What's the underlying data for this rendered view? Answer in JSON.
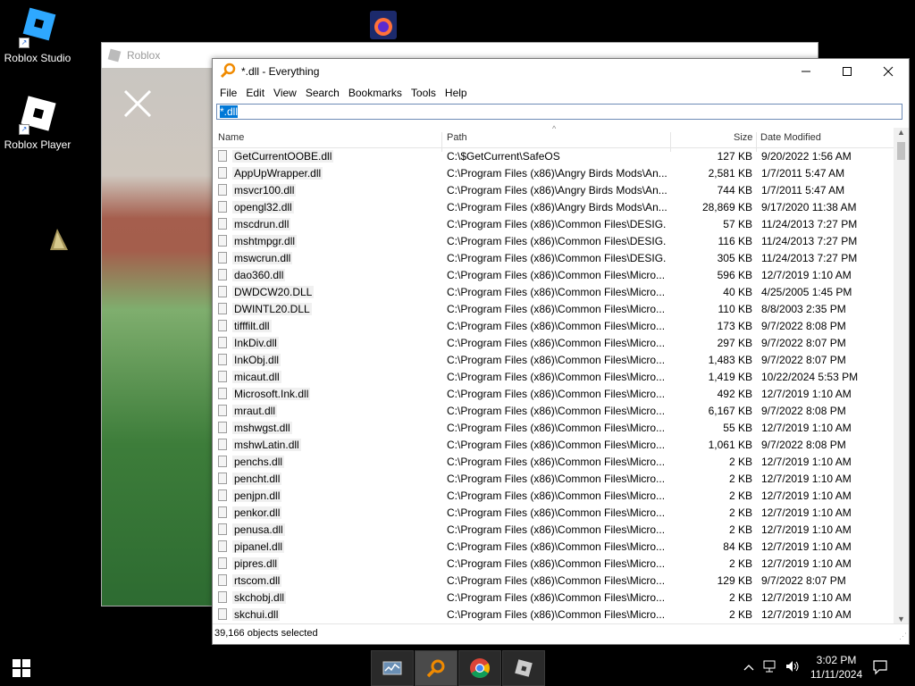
{
  "desktop": {
    "icons": [
      {
        "label": "Roblox Studio"
      },
      {
        "label": "Roblox Player"
      }
    ]
  },
  "roblox_window": {
    "title": "Roblox"
  },
  "everything": {
    "title": "*.dll - Everything",
    "menu": [
      "File",
      "Edit",
      "View",
      "Search",
      "Bookmarks",
      "Tools",
      "Help"
    ],
    "search_value": "*.dll",
    "columns": {
      "name": "Name",
      "path": "Path",
      "size": "Size",
      "date": "Date Modified"
    },
    "rows": [
      {
        "name": "GetCurrentOOBE.dll",
        "path": "C:\\$GetCurrent\\SafeOS",
        "size": "127 KB",
        "date": "9/20/2022 1:56 AM"
      },
      {
        "name": "AppUpWrapper.dll",
        "path": "C:\\Program Files (x86)\\Angry Birds Mods\\An...",
        "size": "2,581 KB",
        "date": "1/7/2011 5:47 AM"
      },
      {
        "name": "msvcr100.dll",
        "path": "C:\\Program Files (x86)\\Angry Birds Mods\\An...",
        "size": "744 KB",
        "date": "1/7/2011 5:47 AM"
      },
      {
        "name": "opengl32.dll",
        "path": "C:\\Program Files (x86)\\Angry Birds Mods\\An...",
        "size": "28,869 KB",
        "date": "9/17/2020 11:38 AM"
      },
      {
        "name": "mscdrun.dll",
        "path": "C:\\Program Files (x86)\\Common Files\\DESIG...",
        "size": "57 KB",
        "date": "11/24/2013 7:27 PM"
      },
      {
        "name": "mshtmpgr.dll",
        "path": "C:\\Program Files (x86)\\Common Files\\DESIG...",
        "size": "116 KB",
        "date": "11/24/2013 7:27 PM"
      },
      {
        "name": "mswcrun.dll",
        "path": "C:\\Program Files (x86)\\Common Files\\DESIG...",
        "size": "305 KB",
        "date": "11/24/2013 7:27 PM"
      },
      {
        "name": "dao360.dll",
        "path": "C:\\Program Files (x86)\\Common Files\\Micro...",
        "size": "596 KB",
        "date": "12/7/2019 1:10 AM"
      },
      {
        "name": "DWDCW20.DLL",
        "path": "C:\\Program Files (x86)\\Common Files\\Micro...",
        "size": "40 KB",
        "date": "4/25/2005 1:45 PM"
      },
      {
        "name": "DWINTL20.DLL",
        "path": "C:\\Program Files (x86)\\Common Files\\Micro...",
        "size": "110 KB",
        "date": "8/8/2003 2:35 PM"
      },
      {
        "name": "tifffilt.dll",
        "path": "C:\\Program Files (x86)\\Common Files\\Micro...",
        "size": "173 KB",
        "date": "9/7/2022 8:08 PM"
      },
      {
        "name": "InkDiv.dll",
        "path": "C:\\Program Files (x86)\\Common Files\\Micro...",
        "size": "297 KB",
        "date": "9/7/2022 8:07 PM"
      },
      {
        "name": "InkObj.dll",
        "path": "C:\\Program Files (x86)\\Common Files\\Micro...",
        "size": "1,483 KB",
        "date": "9/7/2022 8:07 PM"
      },
      {
        "name": "micaut.dll",
        "path": "C:\\Program Files (x86)\\Common Files\\Micro...",
        "size": "1,419 KB",
        "date": "10/22/2024 5:53 PM"
      },
      {
        "name": "Microsoft.Ink.dll",
        "path": "C:\\Program Files (x86)\\Common Files\\Micro...",
        "size": "492 KB",
        "date": "12/7/2019 1:10 AM"
      },
      {
        "name": "mraut.dll",
        "path": "C:\\Program Files (x86)\\Common Files\\Micro...",
        "size": "6,167 KB",
        "date": "9/7/2022 8:08 PM"
      },
      {
        "name": "mshwgst.dll",
        "path": "C:\\Program Files (x86)\\Common Files\\Micro...",
        "size": "55 KB",
        "date": "12/7/2019 1:10 AM"
      },
      {
        "name": "mshwLatin.dll",
        "path": "C:\\Program Files (x86)\\Common Files\\Micro...",
        "size": "1,061 KB",
        "date": "9/7/2022 8:08 PM"
      },
      {
        "name": "penchs.dll",
        "path": "C:\\Program Files (x86)\\Common Files\\Micro...",
        "size": "2 KB",
        "date": "12/7/2019 1:10 AM"
      },
      {
        "name": "pencht.dll",
        "path": "C:\\Program Files (x86)\\Common Files\\Micro...",
        "size": "2 KB",
        "date": "12/7/2019 1:10 AM"
      },
      {
        "name": "penjpn.dll",
        "path": "C:\\Program Files (x86)\\Common Files\\Micro...",
        "size": "2 KB",
        "date": "12/7/2019 1:10 AM"
      },
      {
        "name": "penkor.dll",
        "path": "C:\\Program Files (x86)\\Common Files\\Micro...",
        "size": "2 KB",
        "date": "12/7/2019 1:10 AM"
      },
      {
        "name": "penusa.dll",
        "path": "C:\\Program Files (x86)\\Common Files\\Micro...",
        "size": "2 KB",
        "date": "12/7/2019 1:10 AM"
      },
      {
        "name": "pipanel.dll",
        "path": "C:\\Program Files (x86)\\Common Files\\Micro...",
        "size": "84 KB",
        "date": "12/7/2019 1:10 AM"
      },
      {
        "name": "pipres.dll",
        "path": "C:\\Program Files (x86)\\Common Files\\Micro...",
        "size": "2 KB",
        "date": "12/7/2019 1:10 AM"
      },
      {
        "name": "rtscom.dll",
        "path": "C:\\Program Files (x86)\\Common Files\\Micro...",
        "size": "129 KB",
        "date": "9/7/2022 8:07 PM"
      },
      {
        "name": "skchobj.dll",
        "path": "C:\\Program Files (x86)\\Common Files\\Micro...",
        "size": "2 KB",
        "date": "12/7/2019 1:10 AM"
      },
      {
        "name": "skchui.dll",
        "path": "C:\\Program Files (x86)\\Common Files\\Micro...",
        "size": "2 KB",
        "date": "12/7/2019 1:10 AM"
      }
    ],
    "status": "39,166 objects selected"
  },
  "taskbar": {
    "clock_time": "3:02 PM",
    "clock_date": "11/11/2024"
  },
  "colors": {
    "accent": "#0078d7",
    "taskbar": "#000000"
  }
}
